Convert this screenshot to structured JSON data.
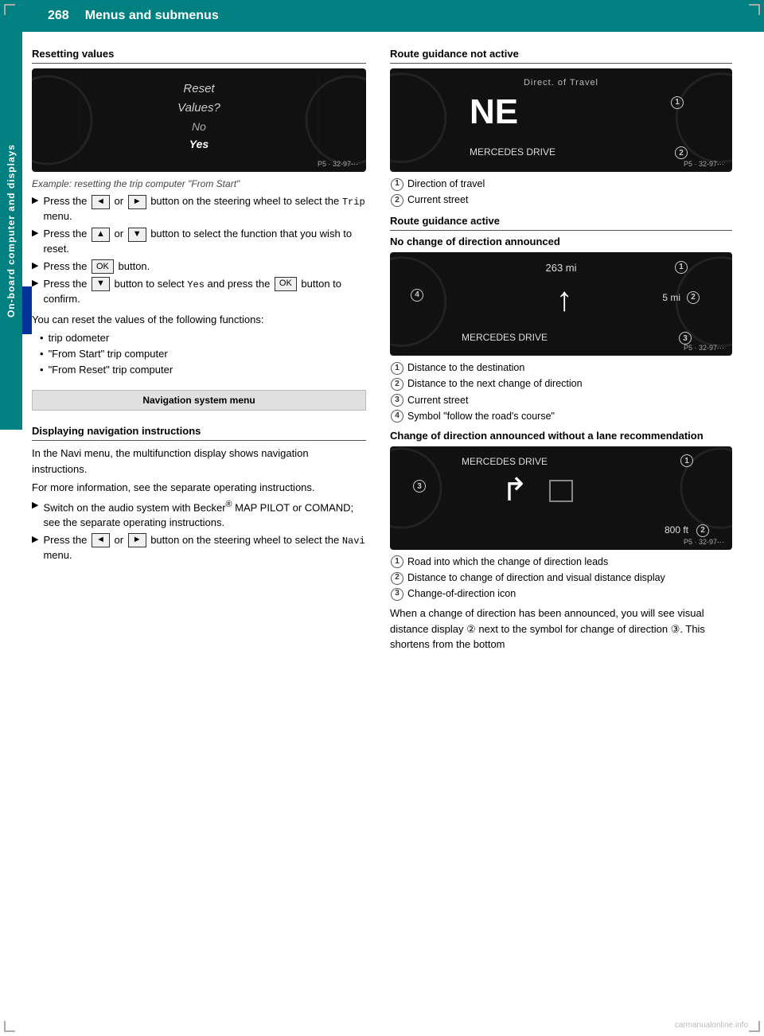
{
  "header": {
    "page_number": "268",
    "title": "Menus and submenus"
  },
  "side_tab": {
    "label": "On-board computer and displays"
  },
  "left_column": {
    "section_resetting": {
      "title": "Resetting values",
      "image_caption": "Example: resetting the trip computer \"From Start\"",
      "image_content": {
        "line1": "Reset",
        "line2": "Values?",
        "line3": "No",
        "line4": "Yes"
      },
      "steps": [
        "Press the  or  button on the steering wheel to select the Trip menu.",
        "Press the  or  button to select the function that you wish to reset.",
        "Press the OK button.",
        "Press the  button to select Yes and press the OK button to confirm."
      ],
      "intro": "You can reset the values of the following functions:",
      "bullets": [
        "trip odometer",
        "\"From Start\" trip computer",
        "\"From Reset\" trip computer"
      ]
    },
    "nav_box": "Navigation system menu",
    "section_displaying": {
      "title": "Displaying navigation instructions",
      "para1": "In the Navi menu, the multifunction display shows navigation instructions.",
      "para2": "For more information, see the separate operating instructions.",
      "steps": [
        "Switch on the audio system with Becker® MAP PILOT or COMAND; see the separate operating instructions.",
        "Press the  or  button on the steering wheel to select the Navi menu."
      ]
    }
  },
  "right_column": {
    "section_not_active": {
      "title": "Route guidance not active",
      "image": {
        "dir_of_travel": "Direct. of Travel",
        "ne": "NE",
        "mercedes_drive": "MERCEDES DRIVE"
      },
      "captions": [
        {
          "num": "1",
          "text": "Direction of travel"
        },
        {
          "num": "2",
          "text": "Current street"
        }
      ]
    },
    "section_active": {
      "title": "Route guidance active",
      "subtitle_no_change": "No change of direction announced",
      "image_no_change": {
        "dist_main": "263 mi",
        "dist_small": "5 mi",
        "mercedes_drive": "MERCEDES DRIVE"
      },
      "captions_no_change": [
        {
          "num": "1",
          "text": "Distance to the destination"
        },
        {
          "num": "2",
          "text": "Distance to the next change of direction"
        },
        {
          "num": "3",
          "text": "Current street"
        },
        {
          "num": "4",
          "text": "Symbol \"follow the road's course\""
        }
      ],
      "subtitle_change": "Change of direction announced without a lane recommendation",
      "image_change": {
        "mercedes_drive": "MERCEDES DRIVE",
        "dist_800": "800 ft"
      },
      "captions_change": [
        {
          "num": "1",
          "text": "Road into which the change of direction leads"
        },
        {
          "num": "2",
          "text": "Distance to change of direction and visual distance display"
        },
        {
          "num": "3",
          "text": "Change-of-direction icon"
        }
      ],
      "para_final": "When a change of direction has been announced, you will see visual distance display ② next to the symbol for change of direction ③. This shortens from the bottom"
    }
  },
  "buttons": {
    "left_arrow": "◄",
    "right_arrow": "►",
    "up_arrow": "▲",
    "down_arrow": "▼",
    "ok": "OK"
  }
}
